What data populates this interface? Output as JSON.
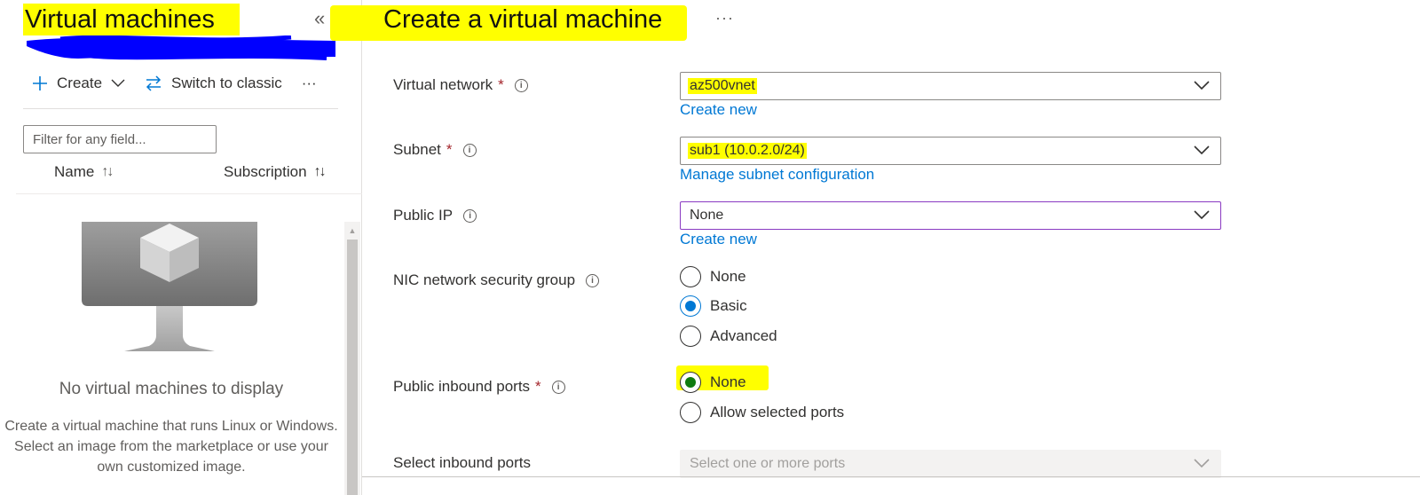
{
  "left_pane": {
    "title": "Virtual machines",
    "collapse_glyph": "«",
    "toolbar": {
      "create_label": "Create",
      "switch_label": "Switch to classic",
      "more_glyph": "···"
    },
    "filter": {
      "placeholder": "Filter for any field..."
    },
    "columns": [
      {
        "label": "Name",
        "sort_glyph": "↑↓"
      },
      {
        "label": "Subscription",
        "sort_glyph": "↑↓"
      }
    ],
    "empty_state": {
      "title": "No virtual machines to display",
      "description": "Create a virtual machine that runs Linux or Windows. Select an image from the marketplace or use your own customized image."
    }
  },
  "right_pane": {
    "title": "Create a virtual machine",
    "more_glyph": "···",
    "fields": {
      "virtual_network": {
        "label": "Virtual network",
        "required": "*",
        "value": "az500vnet",
        "link": "Create new"
      },
      "subnet": {
        "label": "Subnet",
        "required": "*",
        "value": "sub1 (10.0.2.0/24)",
        "link": "Manage subnet configuration"
      },
      "public_ip": {
        "label": "Public IP",
        "value": "None",
        "link": "Create new"
      },
      "nic_nsg": {
        "label": "NIC network security group",
        "options": [
          "None",
          "Basic",
          "Advanced"
        ],
        "selected": "Basic"
      },
      "public_inbound_ports": {
        "label": "Public inbound ports",
        "required": "*",
        "options": [
          "None",
          "Allow selected ports"
        ],
        "selected": "None"
      },
      "select_inbound_ports": {
        "label": "Select inbound ports",
        "placeholder": "Select one or more ports"
      }
    }
  },
  "colors": {
    "accent": "#0078d4",
    "highlight": "#ffff00",
    "redaction": "#0000ff",
    "required": "#a4262c",
    "selected_green": "#107c10"
  }
}
